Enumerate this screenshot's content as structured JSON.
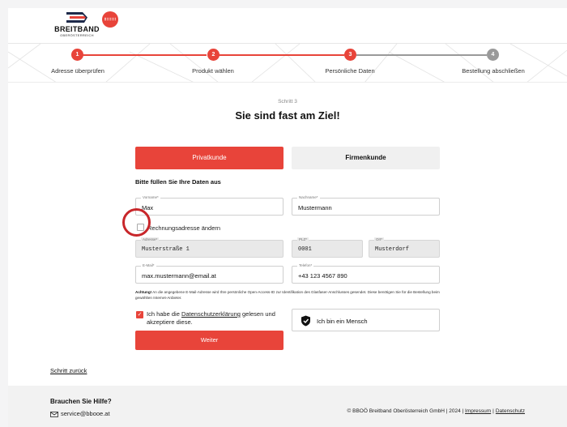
{
  "colors": {
    "accent": "#e8443a",
    "inactive_step": "#9a9a9a",
    "ring": "#c8262a"
  },
  "header": {
    "brand": "BREITBAND",
    "brand_sub": "OBERÖSTERREICH"
  },
  "stepper": {
    "steps": [
      {
        "number": "1",
        "label": "Adresse überprüfen",
        "state": "done"
      },
      {
        "number": "2",
        "label": "Produkt wählen",
        "state": "done"
      },
      {
        "number": "3",
        "label": "Persönliche Daten",
        "state": "current"
      },
      {
        "number": "4",
        "label": "Bestellung abschließen",
        "state": "upcoming"
      }
    ]
  },
  "main": {
    "kicker": "Schritt 3",
    "title": "Sie sind fast am Ziel!",
    "tabs": [
      {
        "label": "Privatkunde",
        "active": true
      },
      {
        "label": "Firmenkunde",
        "active": false
      }
    ],
    "section_title": "Bitte füllen Sie Ihre Daten aus",
    "fields": {
      "vorname": {
        "label": "Vorname*",
        "value": "Max"
      },
      "nachname": {
        "label": "Nachname*",
        "value": "Mustermann"
      },
      "adresse": {
        "label": "Adresse*",
        "value": "Musterstraße 1"
      },
      "plz": {
        "label": "PLZ*",
        "value": "0001"
      },
      "ort": {
        "label": "Ort*",
        "value": "Musterdorf"
      },
      "email": {
        "label": "E-Mail*",
        "value": "max.mustermann@email.at"
      },
      "telefon": {
        "label": "Telefon*",
        "value": "+43 123 4567 890"
      }
    },
    "billing_checkbox": {
      "label": "Rechnungsadresse ändern",
      "checked": false
    },
    "notice": {
      "strong": "Achtung!",
      "text": " An die angegebene E-Mail-Adresse wird Ihre persönliche Open-Access-ID zur Identifikation des Glasfaser-Anschlusses gesendet. Diese benötigen Sie für die Bestellung beim gewählten Internet-Anbieter."
    },
    "consent": {
      "prefix": "Ich habe die ",
      "link": "Datenschutzerklärung",
      "suffix": " gelesen und akzeptiere diese.",
      "checked": true
    },
    "captcha_label": "Ich bin ein Mensch",
    "submit_label": "Weiter",
    "back_label": "Schritt zurück"
  },
  "footer": {
    "help_title": "Brauchen Sie Hilfe?",
    "help_email": "service@bbooe.at",
    "copyright": "© BBOÖ Breitband Oberösterreich GmbH | 2024 |",
    "impressum": "Impressum",
    "datenschutz": "Datenschutz"
  }
}
